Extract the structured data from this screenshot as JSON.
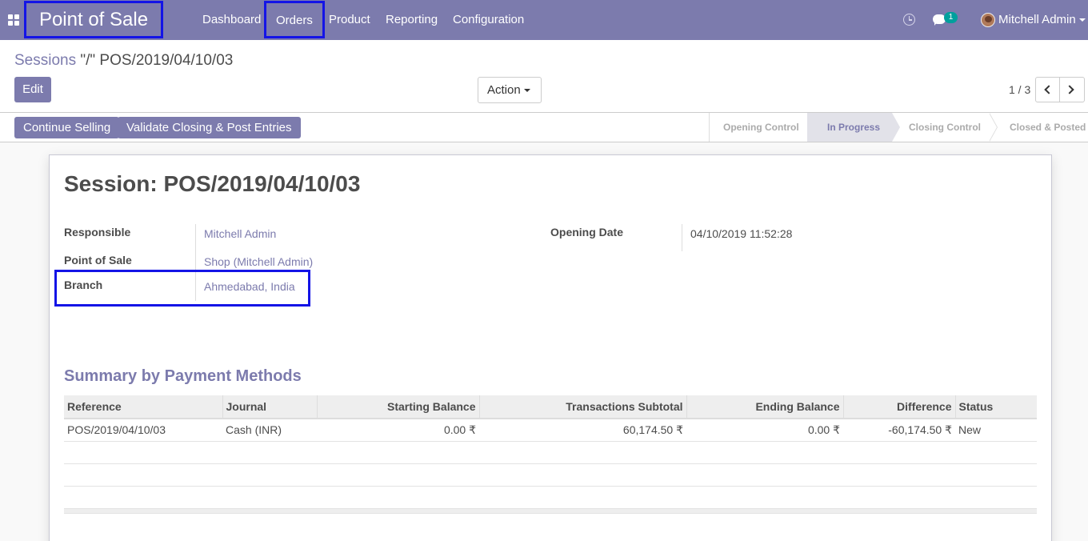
{
  "navbar": {
    "app_title": "Point of Sale",
    "menus": [
      "Dashboard",
      "Orders",
      "Product",
      "Reporting",
      "Configuration"
    ],
    "message_count": "1",
    "user_name": "Mitchell Admin",
    "bg_color": "#7c7bad",
    "highlight_color": "#1414e6"
  },
  "breadcrumb": {
    "parent": "Sessions",
    "current": " \"/\" POS/2019/04/10/03"
  },
  "toolbar": {
    "edit_label": "Edit",
    "action_label": "Action",
    "pager": "1 / 3"
  },
  "statusbar": {
    "buttons": [
      "Continue Selling",
      "Validate Closing & Post Entries"
    ],
    "stages": [
      "Opening Control",
      "In Progress",
      "Closing Control",
      "Closed & Posted"
    ],
    "active_stage": "In Progress"
  },
  "form": {
    "title": "Session: POS/2019/04/10/03",
    "fields": {
      "responsible": {
        "label": "Responsible",
        "value": "Mitchell Admin"
      },
      "point_of_sale": {
        "label": "Point of Sale",
        "value": "Shop (Mitchell Admin)"
      },
      "branch": {
        "label": "Branch",
        "value": "Ahmedabad, India"
      },
      "opening_date": {
        "label": "Opening Date",
        "value": "04/10/2019 11:52:28"
      }
    },
    "summary_title": "Summary by Payment Methods",
    "table": {
      "headers": [
        "Reference",
        "Journal",
        "Starting Balance",
        "Transactions Subtotal",
        "Ending Balance",
        "Difference",
        "Status"
      ],
      "rows": [
        [
          "POS/2019/04/10/03",
          "Cash (INR)",
          "0.00 ₹",
          "60,174.50 ₹",
          "0.00 ₹",
          "-60,174.50 ₹",
          "New"
        ]
      ]
    }
  }
}
